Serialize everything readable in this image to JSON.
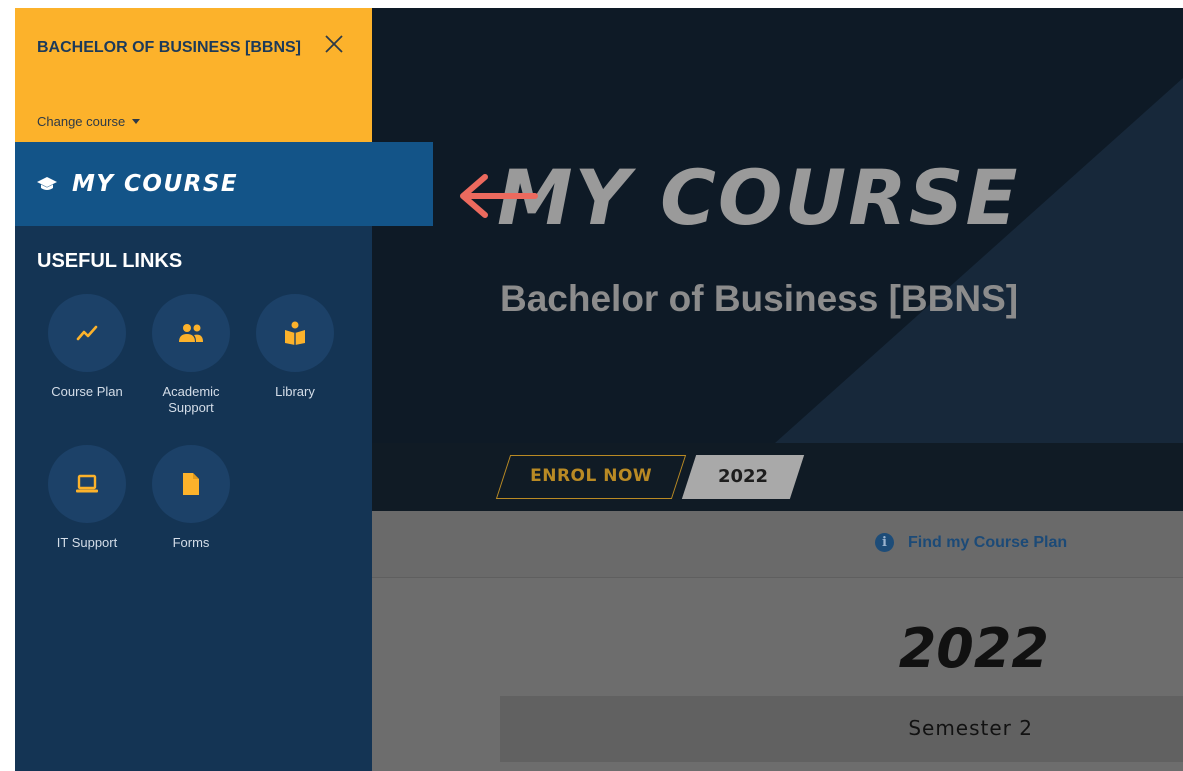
{
  "sidebar": {
    "course_name": "BACHELOR OF BUSINESS [BBNS]",
    "change_course_label": "Change course",
    "my_course_label": "MY COURSE",
    "useful_links_heading": "USEFUL LINKS",
    "links": [
      {
        "label": "Course Plan",
        "icon": "course-plan-chart-icon"
      },
      {
        "label": "Academic Support",
        "icon": "people-icon"
      },
      {
        "label": "Library",
        "icon": "book-reader-icon"
      },
      {
        "label": "IT Support",
        "icon": "laptop-icon"
      },
      {
        "label": "Forms",
        "icon": "document-icon"
      }
    ]
  },
  "main": {
    "hero_title": "MY COURSE",
    "hero_subtitle": "Bachelor of Business [BBNS]",
    "enrol_label": "ENROL NOW",
    "year_tab": "2022",
    "find_plan_label": "Find my Course Plan",
    "year_heading": "2022",
    "semester_label": "Semester 2"
  },
  "colors": {
    "accent_yellow": "#fcb22b",
    "sidebar_navy": "#143454",
    "active_blue": "#135488",
    "arrow_red": "#ec6a5e"
  }
}
